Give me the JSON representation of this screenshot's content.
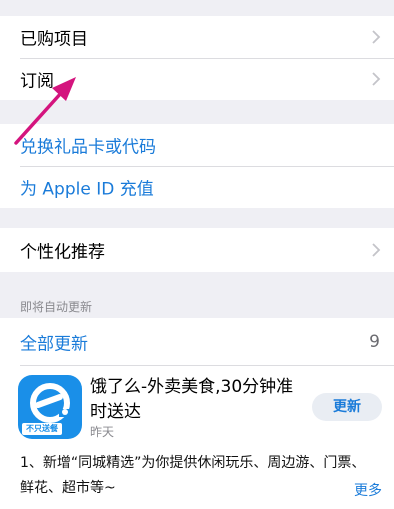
{
  "group1": {
    "purchased": "已购项目",
    "subscriptions": "订阅"
  },
  "group2": {
    "redeem": "兑换礼品卡或代码",
    "add_funds": "为 Apple ID 充值"
  },
  "group3": {
    "personalized": "个性化推荐"
  },
  "updates": {
    "section_header": "即将自动更新",
    "update_all": "全部更新",
    "count": "9",
    "app": {
      "name": "饿了么-外卖美食,30分钟准时送达",
      "icon_tag": "不只送餐",
      "date": "昨天",
      "button": "更新",
      "notes": "1、新增“同城精选”为你提供休闲玩乐、周边游、门票、鲜花、超市等~",
      "more": "更多"
    }
  },
  "colors": {
    "accent": "#1a7bd9",
    "background": "#efeff4",
    "annotation_arrow": "#d4147e",
    "app_icon": "#1a8fe8"
  },
  "icons": [
    "chevron-right-icon",
    "eleme-app-icon",
    "annotation-arrow"
  ]
}
